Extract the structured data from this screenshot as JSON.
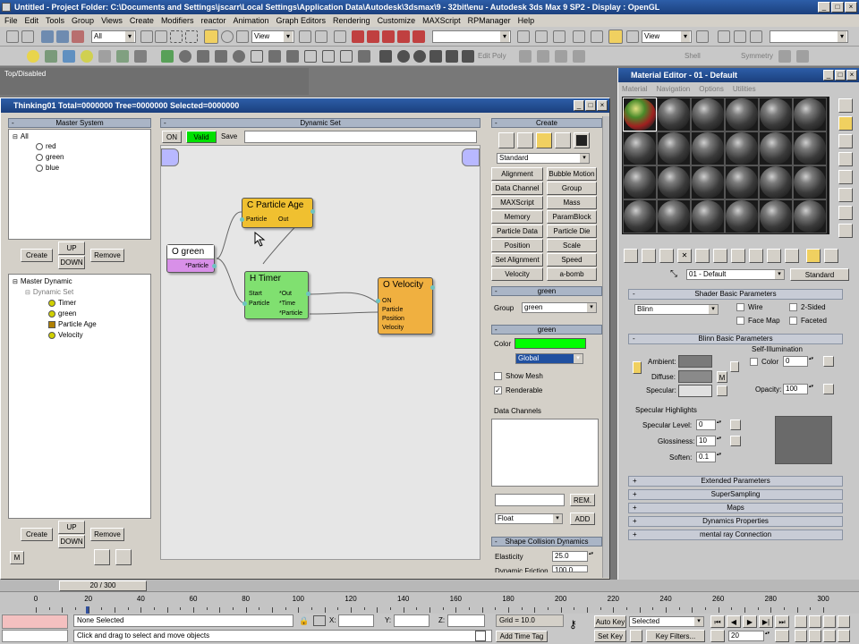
{
  "title_bar": {
    "text": "Untitled     - Project Folder: C:\\Documents and Settings\\jscarr\\Local Settings\\Application Data\\Autodesk\\3dsmax\\9 - 32bit\\enu     - Autodesk 3ds Max 9 SP2     - Display : OpenGL"
  },
  "menu": [
    "File",
    "Edit",
    "Tools",
    "Group",
    "Views",
    "Create",
    "Modifiers",
    "reactor",
    "Animation",
    "Graph Editors",
    "Rendering",
    "Customize",
    "MAXScript",
    "RPManager",
    "Help"
  ],
  "toolbar": {
    "selection_filter": "All",
    "ref_coord": "View",
    "named_sel": "",
    "ref_coord2": "View",
    "edit_poly": "Edit Poly",
    "shell": "Shell",
    "symmetry": "Symmetry"
  },
  "viewport": {
    "label": "Top/Disabled"
  },
  "thinking_window": {
    "title": "Thinking01  Total=0000000  Tree=0000000  Selected=0000000",
    "master_system": {
      "header": "Master System",
      "tree": [
        "All",
        "red",
        "green",
        "blue"
      ],
      "create": "Create",
      "up": "UP",
      "down": "DOWN",
      "remove": "Remove"
    },
    "master_dynamic": {
      "tree": [
        "Master Dynamic",
        "Dynamic Set",
        "Timer",
        "green",
        "Particle Age",
        "Velocity"
      ],
      "create": "Create",
      "up": "UP",
      "down": "DOWN",
      "remove": "Remove",
      "m": "M"
    },
    "dynamic_set": {
      "header": "Dynamic Set",
      "on": "ON",
      "valid": "Valid",
      "save": "Save",
      "nodes": {
        "particle_age": {
          "title": "C Particle Age",
          "ports": [
            "Particle",
            "Out"
          ]
        },
        "green": {
          "title": "O green",
          "ports": [
            "*Particle"
          ]
        },
        "timer": {
          "title": "H Timer",
          "ports": [
            "Start",
            "Particle",
            "*Out",
            "*Time",
            "*Particle"
          ]
        },
        "velocity": {
          "title": "O Velocity",
          "ports": [
            "ON",
            "Particle",
            "Position",
            "Velocity"
          ]
        }
      }
    },
    "create_panel": {
      "header": "Create",
      "category": "Standard",
      "buttons": [
        "Alignment",
        "Bubble Motion",
        "Data Channel",
        "Group",
        "MAXScript",
        "Mass",
        "Memory",
        "ParamBlock",
        "Particle Data",
        "Particle Die",
        "Position",
        "Scale",
        "Set Alignment",
        "Speed",
        "Velocity",
        "a-bomb"
      ],
      "green_header": "green",
      "group_label": "Group",
      "group_value": "green",
      "green_header2": "green",
      "color_label": "Color",
      "color_value": "#00ff00",
      "color_space": "Global",
      "show_mesh": "Show Mesh",
      "renderable": "Renderable",
      "data_channels": "Data Channels",
      "rem": "REM.",
      "type": "Float",
      "add": "ADD",
      "shape_header": "Shape Collision Dynamics",
      "elasticity_label": "Elasticity",
      "elasticity_value": "25.0",
      "dynamic_friction_label": "Dynamic Friction",
      "dynamic_friction_value": "100.0"
    }
  },
  "material_editor": {
    "title": "Material Editor - 01 - Default",
    "menu": [
      "Material",
      "Navigation",
      "Options",
      "Utilities"
    ],
    "material_name": "01 - Default",
    "material_type": "Standard",
    "shader_header": "Shader Basic Parameters",
    "shader": "Blinn",
    "wire": "Wire",
    "two_sided": "2-Sided",
    "face_map": "Face Map",
    "faceted": "Faceted",
    "blinn_header": "Blinn Basic Parameters",
    "self_illum": "Self-Illumination",
    "color_label": "Color",
    "self_illum_value": "0",
    "ambient": "Ambient:",
    "diffuse": "Diffuse:",
    "specular": "Specular:",
    "m_button": "M",
    "opacity_label": "Opacity:",
    "opacity_value": "100",
    "spec_highlights": "Specular Highlights",
    "spec_level_label": "Specular Level:",
    "spec_level_value": "0",
    "glossiness_label": "Glossiness:",
    "glossiness_value": "10",
    "soften_label": "Soften:",
    "soften_value": "0.1",
    "rollouts": [
      "Extended Parameters",
      "SuperSampling",
      "Maps",
      "Dynamics Properties",
      "mental ray Connection"
    ]
  },
  "timeline": {
    "frame_label": "20 / 300",
    "ticks": [
      "0",
      "20",
      "40",
      "60",
      "80",
      "100",
      "120",
      "140",
      "160",
      "180",
      "200",
      "220",
      "240",
      "260",
      "280",
      "300"
    ],
    "status_sel": "None Selected",
    "prompt": "Click and drag to select and move objects",
    "x_label": "X:",
    "y_label": "Y:",
    "z_label": "Z:",
    "grid": "Grid = 10.0",
    "add_time_tag": "Add Time Tag",
    "auto_key": "Auto Key",
    "selected": "Selected",
    "set_key": "Set Key",
    "key_filters": "Key Filters...",
    "current_frame": "20"
  }
}
